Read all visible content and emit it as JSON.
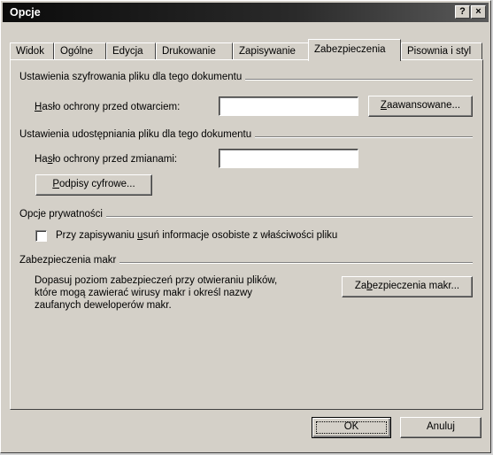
{
  "window": {
    "title": "Opcje",
    "help_glyph": "?",
    "close_glyph": "×"
  },
  "tabs": [
    {
      "label": "Widok",
      "active": false
    },
    {
      "label": "Ogólne",
      "active": false
    },
    {
      "label": "Edycja",
      "active": false
    },
    {
      "label": "Drukowanie",
      "active": false
    },
    {
      "label": "Zapisywanie",
      "active": false
    },
    {
      "label": "Zabezpieczenia",
      "active": true
    },
    {
      "label": "Pisownia i styl",
      "active": false
    }
  ],
  "encryption": {
    "group_label": "Ustawienia szyfrowania pliku dla tego dokumentu",
    "open_password_label_u": "H",
    "open_password_label_rest": "asło ochrony przed otwarciem:",
    "open_password_value": "",
    "advanced_button_u": "Z",
    "advanced_button_rest": "aawansowane..."
  },
  "sharing": {
    "group_label": "Ustawienia udostępniania pliku dla tego dokumentu",
    "modify_password_label_pre": "Ha",
    "modify_password_label_u": "s",
    "modify_password_label_post": "ło ochrony przed zmianami:",
    "modify_password_value": "",
    "digital_signatures_u": "P",
    "digital_signatures_rest": "odpisy cyfrowe..."
  },
  "privacy": {
    "group_label": "Opcje prywatności",
    "remove_info_pre": "Przy zapisywaniu ",
    "remove_info_u": "u",
    "remove_info_post": "suń informacje osobiste z właściwości pliku",
    "remove_info_checked": false
  },
  "macro": {
    "group_label": "Zabezpieczenia makr",
    "description_line1": "Dopasuj poziom zabezpieczeń przy otwieraniu plików,",
    "description_line2": "które mogą zawierać wirusy makr i określ nazwy",
    "description_line3": "zaufanych deweloperów makr.",
    "button_pre": "Za",
    "button_u": "b",
    "button_post": "ezpieczenia makr..."
  },
  "footer": {
    "ok_label": "OK",
    "cancel_label": "Anuluj"
  }
}
